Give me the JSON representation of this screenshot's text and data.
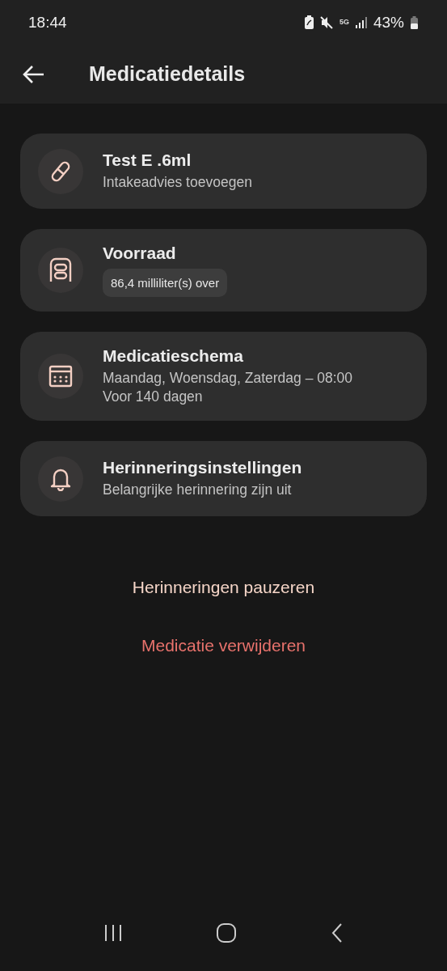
{
  "status_bar": {
    "time": "18:44",
    "network": "5G",
    "battery": "43%"
  },
  "header": {
    "title": "Medicatiedetails"
  },
  "cards": [
    {
      "title": "Test E .6ml",
      "kind": "text",
      "lines": [
        "Intakeadvies toevoegen"
      ]
    },
    {
      "title": "Voorraad",
      "kind": "chip",
      "lines": [
        "86,4 milliliter(s) over"
      ]
    },
    {
      "title": "Medicatieschema",
      "kind": "text",
      "lines": [
        "Maandag, Woensdag, Zaterdag – 08:00",
        "Voor 140 dagen"
      ]
    },
    {
      "title": "Herinneringsinstellingen",
      "kind": "text",
      "lines": [
        "Belangrijke herinnering zijn uit"
      ]
    }
  ],
  "actions": [
    {
      "label": "Herinneringen pauzeren",
      "kind": "neutral"
    },
    {
      "label": "Medicatie verwijderen",
      "kind": "danger"
    }
  ]
}
